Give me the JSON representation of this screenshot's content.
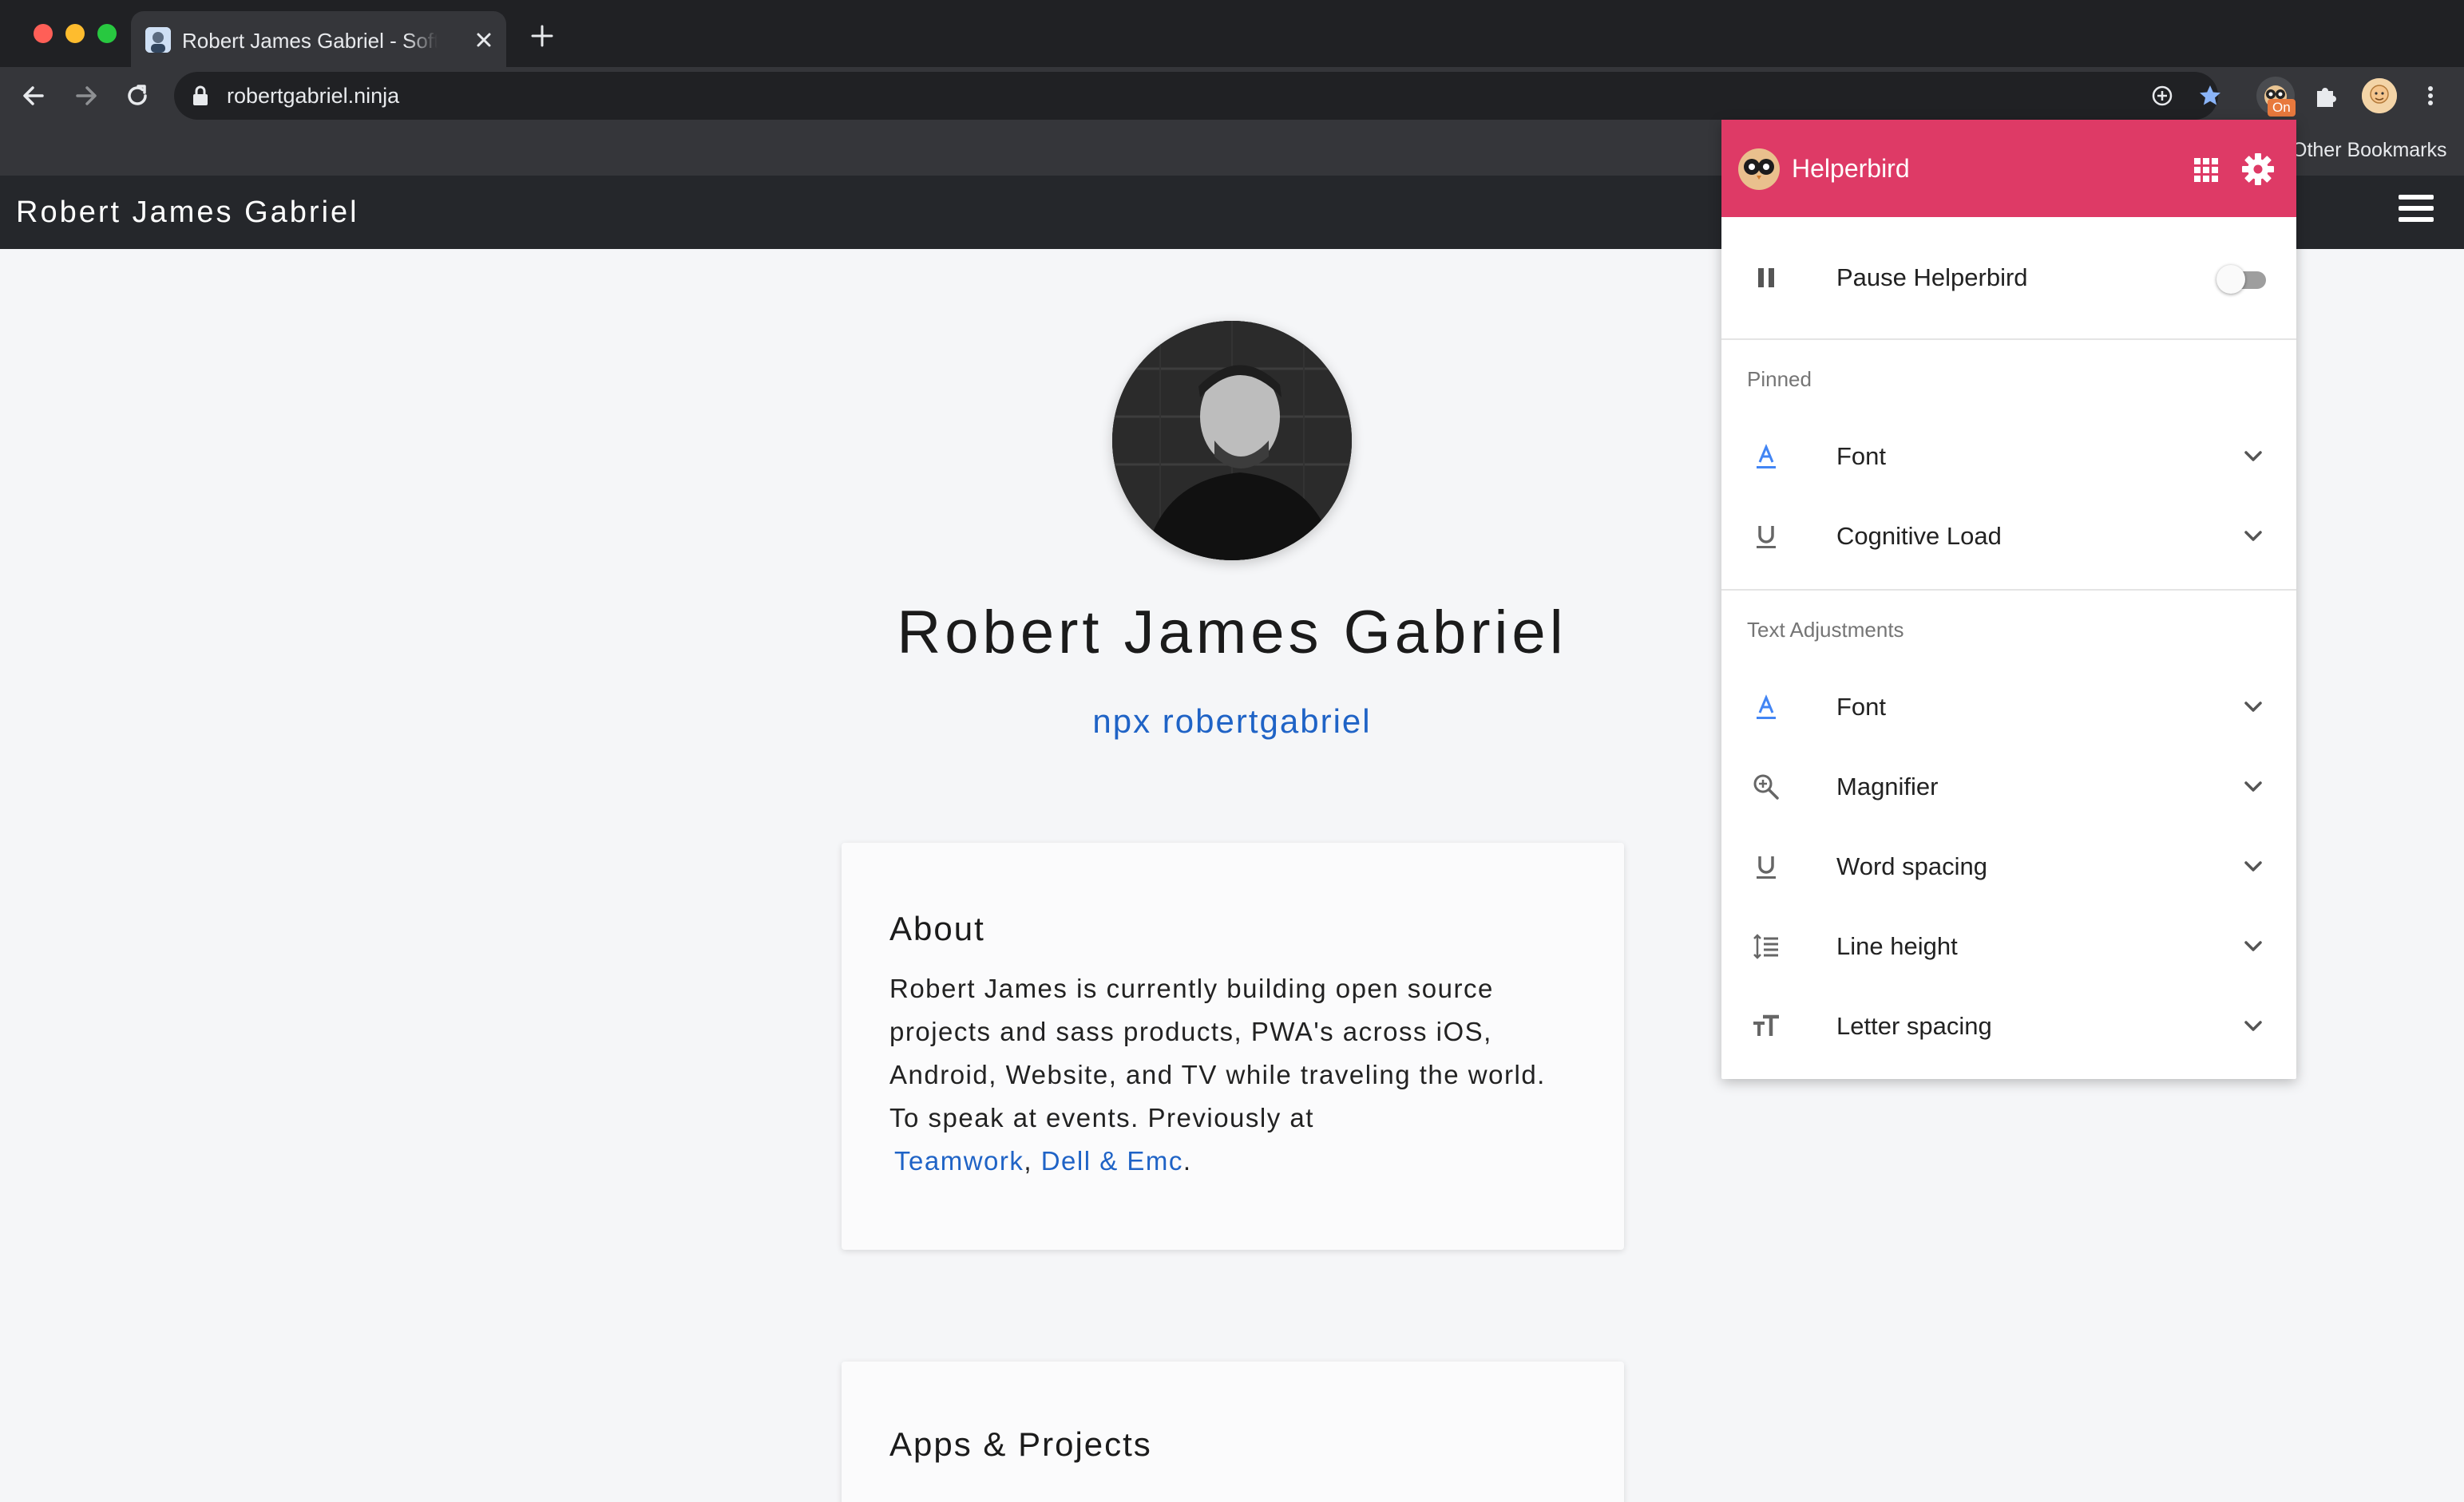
{
  "browser": {
    "tab_title": "Robert James Gabriel - Software Engineer",
    "url": "robertgabriel.ninja",
    "extension_badge": "On",
    "bookmarks_label": "Other Bookmarks"
  },
  "site": {
    "header_title": "Robert James Gabriel",
    "hero_name": "Robert James Gabriel",
    "npx_link": "npx robertgabriel",
    "about": {
      "heading": "About",
      "text": "Robert James is currently building open source projects and sass products, PWA's across iOS, Android, Website, and TV while traveling the world. To speak at events. Previously at",
      "link1": "Teamwork",
      "sep": ",",
      "link2": "Dell & Emc",
      "end": "."
    },
    "apps": {
      "heading": "Apps & Projects"
    }
  },
  "helperbird": {
    "title": "Helperbird",
    "pause_label": "Pause Helperbird",
    "pause_enabled": false,
    "pinned_label": "Pinned",
    "pinned": [
      {
        "label": "Font",
        "icon": "font-icon"
      },
      {
        "label": "Cognitive Load",
        "icon": "underline-icon"
      }
    ],
    "text_adjust_label": "Text Adjustments",
    "text_adjustments": [
      {
        "label": "Font",
        "icon": "font-icon"
      },
      {
        "label": "Magnifier",
        "icon": "magnifier-icon"
      },
      {
        "label": "Word spacing",
        "icon": "underline-icon"
      },
      {
        "label": "Line height",
        "icon": "line-height-icon"
      },
      {
        "label": "Letter spacing",
        "icon": "text-size-icon"
      }
    ],
    "header_color": "#de3a66"
  }
}
